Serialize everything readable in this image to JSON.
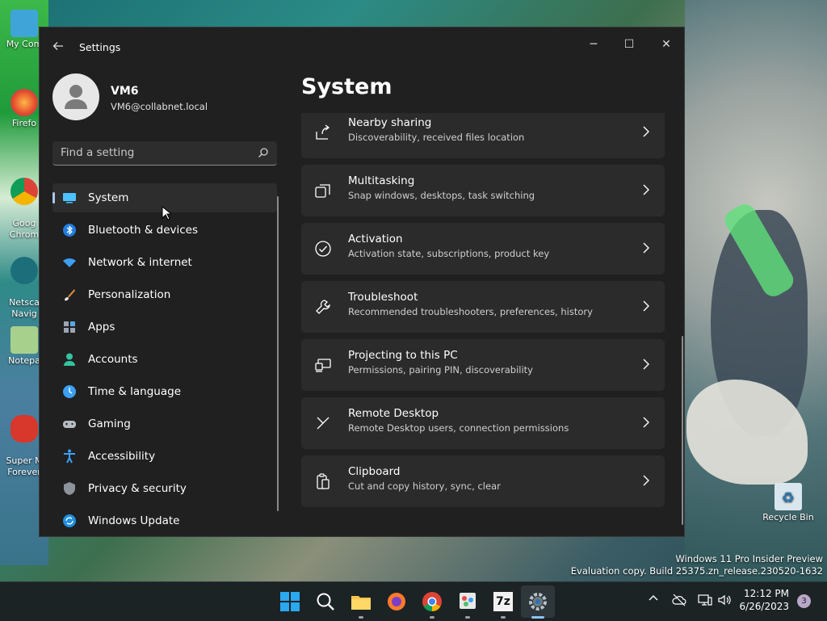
{
  "window": {
    "title": "Settings",
    "minimize_glyph": "─",
    "maximize_glyph": "☐",
    "close_glyph": "✕"
  },
  "profile": {
    "name": "VM6",
    "email": "VM6@collabnet.local"
  },
  "search": {
    "placeholder": "Find a setting"
  },
  "nav": {
    "items": [
      {
        "label": "System",
        "icon": "system-icon",
        "active": true
      },
      {
        "label": "Bluetooth & devices",
        "icon": "bluetooth-icon"
      },
      {
        "label": "Network & internet",
        "icon": "network-icon"
      },
      {
        "label": "Personalization",
        "icon": "personalization-icon"
      },
      {
        "label": "Apps",
        "icon": "apps-icon"
      },
      {
        "label": "Accounts",
        "icon": "accounts-icon"
      },
      {
        "label": "Time & language",
        "icon": "time-language-icon"
      },
      {
        "label": "Gaming",
        "icon": "gaming-icon"
      },
      {
        "label": "Accessibility",
        "icon": "accessibility-icon"
      },
      {
        "label": "Privacy & security",
        "icon": "privacy-icon"
      },
      {
        "label": "Windows Update",
        "icon": "windows-update-icon"
      }
    ]
  },
  "main": {
    "title": "System",
    "cards": [
      {
        "title": "Nearby sharing",
        "subtitle": "Discoverability, received files location",
        "icon": "nearby-sharing-icon"
      },
      {
        "title": "Multitasking",
        "subtitle": "Snap windows, desktops, task switching",
        "icon": "multitasking-icon"
      },
      {
        "title": "Activation",
        "subtitle": "Activation state, subscriptions, product key",
        "icon": "activation-icon"
      },
      {
        "title": "Troubleshoot",
        "subtitle": "Recommended troubleshooters, preferences, history",
        "icon": "troubleshoot-icon"
      },
      {
        "title": "Projecting to this PC",
        "subtitle": "Permissions, pairing PIN, discoverability",
        "icon": "projecting-icon"
      },
      {
        "title": "Remote Desktop",
        "subtitle": "Remote Desktop users, connection permissions",
        "icon": "remote-desktop-icon"
      },
      {
        "title": "Clipboard",
        "subtitle": "Cut and copy history, sync, clear",
        "icon": "clipboard-icon"
      }
    ]
  },
  "desktop": {
    "icons": [
      {
        "label": "My Com",
        "icon": "computer-icon"
      },
      {
        "label": "Firefo",
        "icon": "firefox-icon"
      },
      {
        "label": "Goog\nChrom",
        "icon": "chrome-icon"
      },
      {
        "label": "Netsca\nNavig",
        "icon": "netscape-icon"
      },
      {
        "label": "Notepa",
        "icon": "notepad-icon"
      },
      {
        "label": "Super M\nForever",
        "icon": "mario-icon"
      },
      {
        "label": "Recycle Bin",
        "icon": "recycle-bin-icon"
      }
    ]
  },
  "watermark": {
    "line1": "Windows 11 Pro Insider Preview",
    "line2": "Evaluation copy. Build 25375.zn_release.230520-1632"
  },
  "taskbar": {
    "apps": [
      "start-icon",
      "search-icon",
      "file-explorer-icon",
      "firefox-icon",
      "chrome-icon",
      "paint-icon",
      "7zip-icon",
      "settings-icon"
    ],
    "time": "12:12 PM",
    "date": "6/26/2023",
    "notification_count": "3",
    "seven_zip_label": "7z"
  },
  "colors": {
    "window_bg": "#202020",
    "card_bg": "#2b2b2b",
    "accent": "#a9c8e8",
    "taskbar_bg": "#1c2325"
  }
}
